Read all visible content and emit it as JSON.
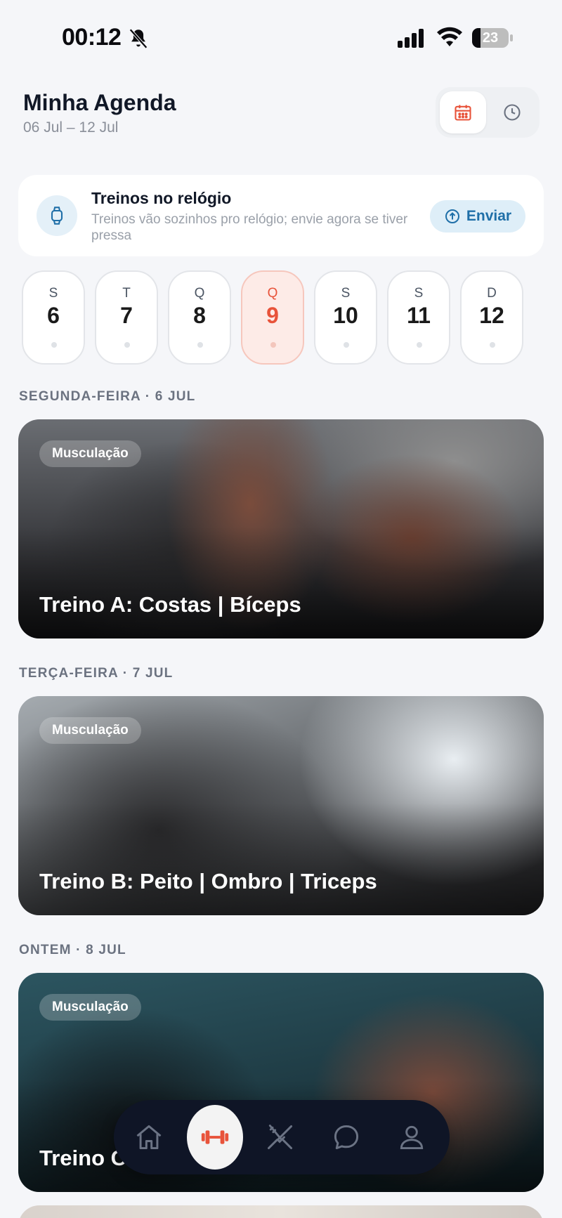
{
  "status_bar": {
    "time": "00:12",
    "battery_level": "23"
  },
  "header": {
    "title": "Minha Agenda",
    "date_range": "06 Jul – 12 Jul"
  },
  "watch_card": {
    "title": "Treinos no relógio",
    "description": "Treinos vão sozinhos pro relógio; envie agora se tiver pressa",
    "send_label": "Enviar"
  },
  "days": [
    {
      "letter": "S",
      "number": "6"
    },
    {
      "letter": "T",
      "number": "7"
    },
    {
      "letter": "Q",
      "number": "8"
    },
    {
      "letter": "Q",
      "number": "9",
      "active": true
    },
    {
      "letter": "S",
      "number": "10"
    },
    {
      "letter": "S",
      "number": "11"
    },
    {
      "letter": "D",
      "number": "12"
    }
  ],
  "sections": [
    {
      "label": "SEGUNDA-FEIRA · 6 JUL",
      "tag": "Musculação",
      "title": "Treino A: Costas | Bíceps"
    },
    {
      "label": "TERÇA-FEIRA · 7 JUL",
      "tag": "Musculação",
      "title": "Treino B: Peito | Ombro | Triceps"
    },
    {
      "label": "ONTEM · 8 JUL",
      "tag": "Musculação",
      "title": "Treino C"
    }
  ],
  "bottom_nav": [
    {
      "icon": "home-icon"
    },
    {
      "icon": "dumbbell-icon",
      "active": true
    },
    {
      "icon": "fork-knife-icon"
    },
    {
      "icon": "chat-bubble-icon"
    },
    {
      "icon": "user-icon"
    }
  ],
  "colors": {
    "accent": "#e8533a",
    "nav_bg": "#0f1526",
    "link": "#1f6fa8",
    "page_bg": "#f5f6f9"
  }
}
